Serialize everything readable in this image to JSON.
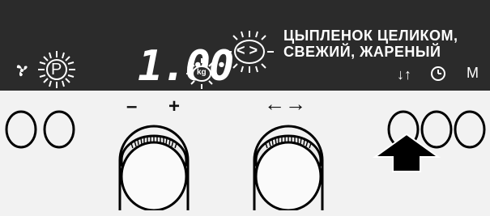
{
  "display": {
    "weight_value": "1.00",
    "weight_unit": "kg",
    "program_p_label": "P",
    "program_name_line1": "ЦЫПЛЕНОК ЦЕЛИКОМ,",
    "program_name_line2": "СВЕЖИЙ, ЖАРЕНЫЙ",
    "nav_icon": "< >",
    "icons": {
      "stirring": "fan-icon",
      "sort": "arrows-updown-icon",
      "clock": "clock-icon",
      "memory": "M"
    },
    "sort_label": "↓↑",
    "memory_label": "M"
  },
  "controls": {
    "minus_label": "–",
    "plus_label": "+",
    "left_right_label": "←→"
  },
  "colors": {
    "display_bg": "#2b2b2b",
    "display_text": "#ffffff",
    "panel_bg": "#f2f2f2",
    "arrow": "#000000"
  }
}
